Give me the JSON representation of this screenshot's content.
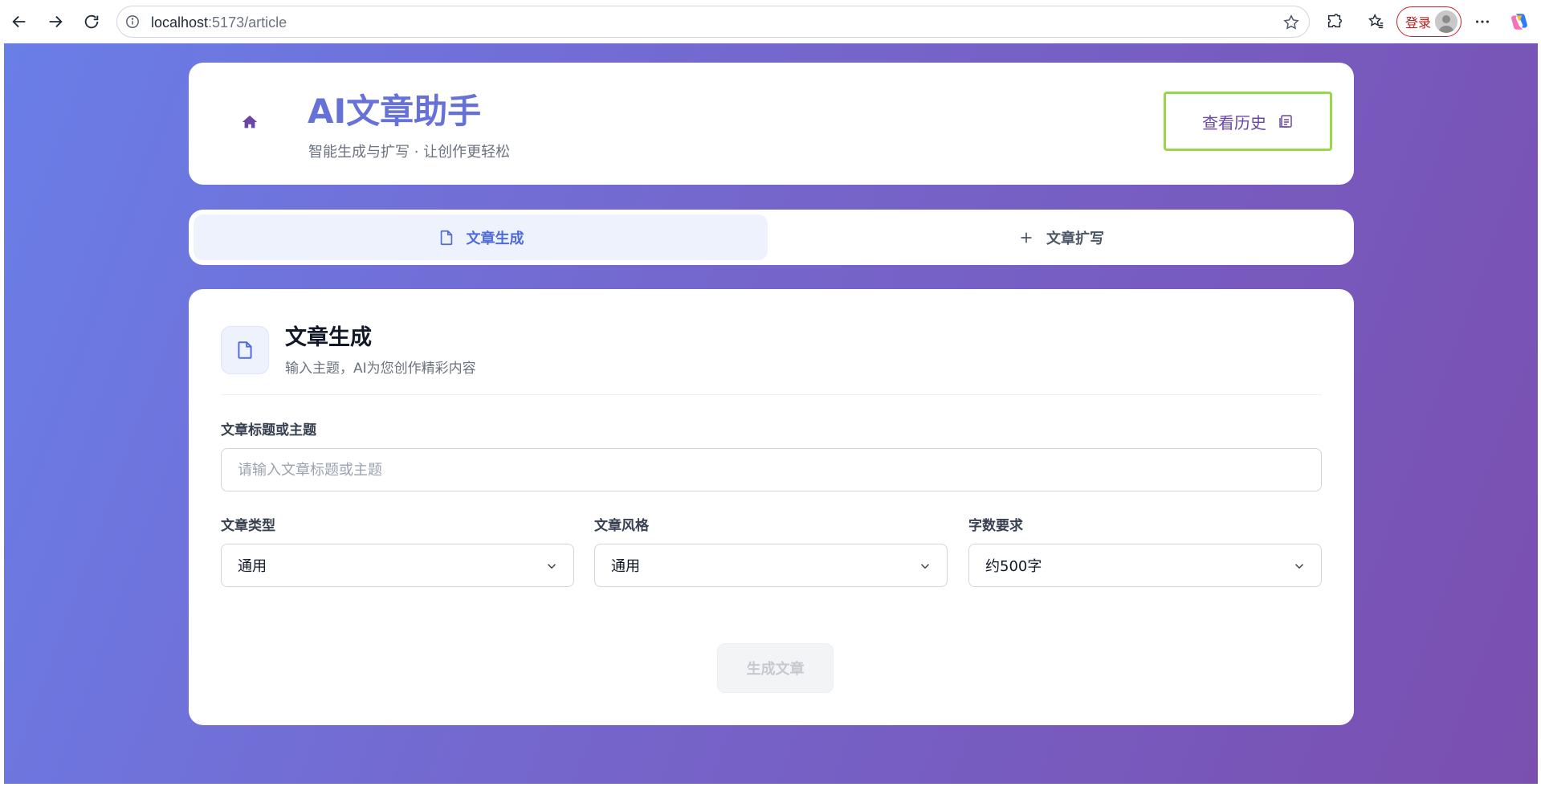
{
  "browser": {
    "url_host": "localhost",
    "url_path": ":5173/article",
    "login_label": "登录"
  },
  "header": {
    "title": "AI文章助手",
    "subtitle": "智能生成与扩写 · 让创作更轻松",
    "history_button": "查看历史"
  },
  "tabs": [
    {
      "label": "文章生成",
      "active": true
    },
    {
      "label": "文章扩写",
      "active": false
    }
  ],
  "form": {
    "section_title": "文章生成",
    "section_subtitle": "输入主题，AI为您创作精彩内容",
    "topic_label": "文章标题或主题",
    "topic_placeholder": "请输入文章标题或主题",
    "type_label": "文章类型",
    "type_value": "通用",
    "style_label": "文章风格",
    "style_value": "通用",
    "length_label": "字数要求",
    "length_value": "约500字",
    "generate_button": "生成文章"
  },
  "colors": {
    "accent": "#6672d8",
    "tab_active": "#4f6bd8",
    "history_border": "#9ad64b",
    "gradient_start": "#6a7ee8",
    "gradient_end": "#7a4fb0"
  }
}
